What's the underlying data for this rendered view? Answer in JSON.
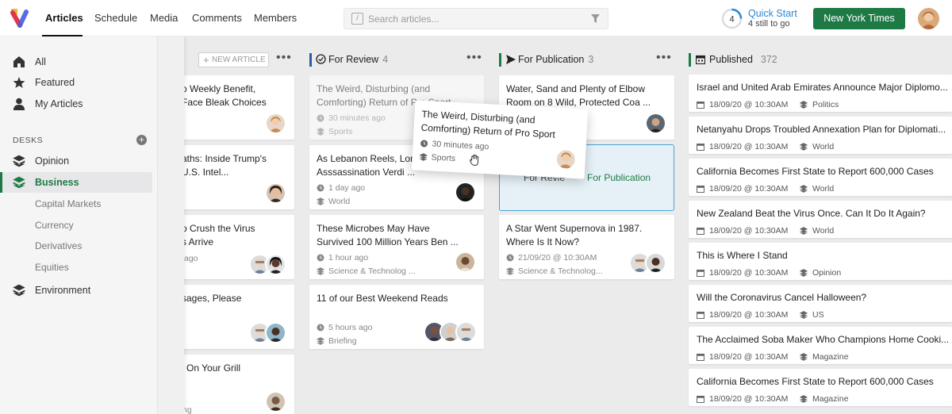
{
  "nav": {
    "tabs": [
      "Articles",
      "Schedule",
      "Media",
      "Comments",
      "Members"
    ],
    "active": "Articles"
  },
  "search": {
    "placeholder": "Search articles..."
  },
  "quick_start": {
    "count": "4",
    "title": "Quick Start",
    "subtitle": "4 still to go"
  },
  "org_button": "New York Times",
  "sidebar": {
    "main": [
      "All",
      "Featured",
      "My Articles"
    ],
    "desks_heading": "DESKS",
    "desks": [
      "Opinion",
      "Business"
    ],
    "active_desk": "Business",
    "business_sub": [
      "Capital Markets",
      "Currency",
      "Derivatives",
      "Equities"
    ],
    "environment": "Environment"
  },
  "columns": {
    "draft": {
      "new_label": "NEW ARTICLE",
      "cards": [
        {
          "line1": "o Weekly Benefit,",
          "line2": "Face Bleak Choices"
        },
        {
          "line1": "aths: Inside Trump's",
          "line2": "U.S. Intel..."
        },
        {
          "line1": "o Crush the Virus",
          "line2": "s Arrive",
          "meta": "ago"
        },
        {
          "line1": "sages, Please",
          "line2": ""
        },
        {
          "line1": "On Your Grill",
          "line2": "",
          "meta": "ng"
        }
      ]
    },
    "review": {
      "title": "For Review",
      "count": "4",
      "cards": [
        {
          "line1": "The Weird, Disturbing (and",
          "line2": "Comforting) Return of Pro Sport ...",
          "time": "30 minutes ago",
          "section": "Sports"
        },
        {
          "line1": "As Lebanon Reels, Lon",
          "line2": "Asssassination Verdi ...",
          "time": "1 day ago",
          "section": "World"
        },
        {
          "line1": "These Microbes May Have",
          "line2": "Survived 100 Million Years Ben ...",
          "time": "1 hour ago",
          "section": "Science & Technolog ..."
        },
        {
          "line1": "11 of our Best Weekend Reads",
          "line2": "",
          "time": "5 hours ago",
          "section": "Briefing"
        }
      ]
    },
    "publication": {
      "title": "For Publication",
      "count": "3",
      "cards": [
        {
          "line1": "Water, Sand and Plenty of Elbow",
          "line2": "Room on 8 Wild, Protected Coa ..."
        },
        {
          "line1": "A Star Went Supernova in 1987.",
          "line2": "Where Is It Now?",
          "time": "21/09/20 @ 10:30AM",
          "section": "Science & Technolog..."
        }
      ],
      "drop_ghost": "For Revie",
      "drop_label": "For Publication"
    },
    "published": {
      "title": "Published",
      "count": "372",
      "cards": [
        {
          "title": "Israel and United Arab Emirates Announce Major Diplomo...",
          "date": "18/09/20 @ 10:30AM",
          "section": "Politics"
        },
        {
          "title": "Netanyahu Drops Troubled Annexation Plan for Diplomati...",
          "date": "18/09/20 @ 10:30AM",
          "section": "World"
        },
        {
          "title": "California Becomes First State to Report 600,000 Cases",
          "date": "18/09/20 @ 10:30AM",
          "section": "World"
        },
        {
          "title": "New Zealand Beat the Virus Once. Can It Do It Again?",
          "date": "18/09/20 @ 10:30AM",
          "section": "World"
        },
        {
          "title": "This is Where I Stand",
          "date": "18/09/20 @ 10:30AM",
          "section": "Opinion"
        },
        {
          "title": "Will the Coronavirus Cancel Halloween?",
          "date": "18/09/20 @ 10:30AM",
          "section": "US"
        },
        {
          "title": "The Acclaimed Soba Maker Who Champions Home Cooki...",
          "date": "18/09/20 @ 10:30AM",
          "section": "Magazine"
        },
        {
          "title": "California Becomes First State to Report 600,000 Cases",
          "date": "18/09/20 @ 10:30AM",
          "section": "Magazine"
        }
      ]
    }
  },
  "dragging": {
    "line1": "The Weird, Disturbing (and",
    "line2": "Comforting) Return of Pro Sport ...",
    "time": "30 minutes ago",
    "section": "Sports"
  },
  "colors": {
    "brand_green": "#1e7a44",
    "accent_blue": "#2b87d8",
    "review_accent": "#2a5da8",
    "publication_accent": "#1e7a44"
  }
}
